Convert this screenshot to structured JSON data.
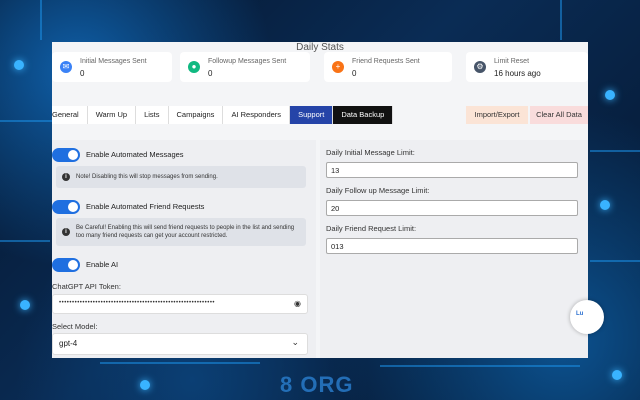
{
  "header": {
    "daily_stats_title": "Daily Stats"
  },
  "stats": [
    {
      "label": "Initial Messages Sent",
      "value": "0",
      "icon": "message-icon",
      "color": "#3b82f6"
    },
    {
      "label": "Followup Messages Sent",
      "value": "0",
      "icon": "chat-icon",
      "color": "#10b981"
    },
    {
      "label": "Friend Requests Sent",
      "value": "0",
      "icon": "user-plus-icon",
      "color": "#f97316"
    },
    {
      "label": "Limit Reset",
      "value": "16 hours ago",
      "icon": "gear-icon",
      "color": "#475569"
    }
  ],
  "tabs": [
    {
      "label": "General"
    },
    {
      "label": "Warm Up"
    },
    {
      "label": "Lists"
    },
    {
      "label": "Campaigns"
    },
    {
      "label": "AI Responders"
    },
    {
      "label": "Support"
    },
    {
      "label": "Data Backup"
    }
  ],
  "actions": {
    "import_export": "Import/Export",
    "clear_all": "Clear All Data"
  },
  "toggles": {
    "automated_messages": "Enable Automated Messages",
    "automated_friend_requests": "Enable Automated Friend Requests",
    "enable_ai": "Enable AI"
  },
  "notes": {
    "messages": "Note! Disabling this will stop messages from sending.",
    "friend_requests": "Be Careful! Enabling this will send friend requests to people in the list and sending too many friend requests can get your account restricted."
  },
  "ai": {
    "token_label": "ChatGPT API Token:",
    "token_value": "••••••••••••••••••••••••••••••••••••••••••••••••••••••••••••",
    "model_label": "Select Model:",
    "model_value": "gpt-4"
  },
  "limits": {
    "initial_label": "Daily Initial Message Limit:",
    "initial_value": "13",
    "followup_label": "Daily Follow up Message Limit:",
    "followup_value": "20",
    "friend_label": "Daily Friend Request Limit:",
    "friend_value": "013"
  },
  "background": {
    "text": "8 ORG"
  },
  "chat_widget": {
    "label": "Lu"
  }
}
